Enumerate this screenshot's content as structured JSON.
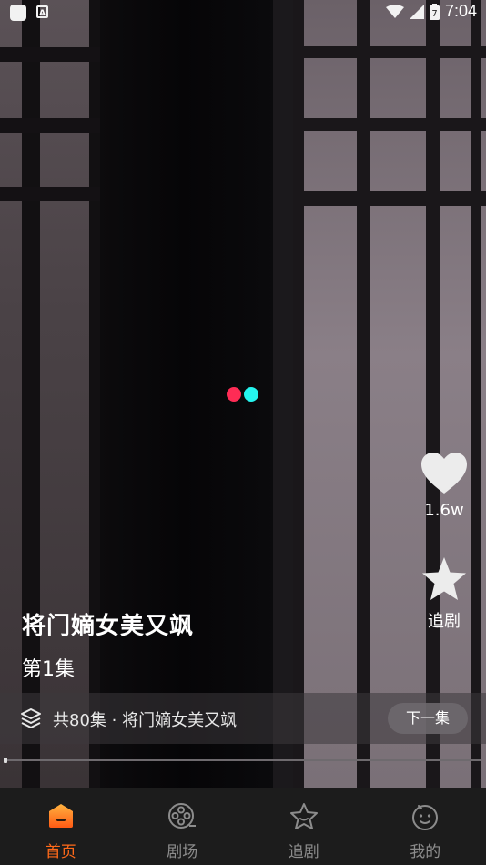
{
  "status_bar": {
    "time": "7:04",
    "icons": [
      "notification-square-icon",
      "a-badge-icon",
      "wifi-icon",
      "signal-icon",
      "battery-icon"
    ],
    "battery_level": "7"
  },
  "loading_indicator": {
    "colors": [
      "#fe2c55",
      "#25f4ee"
    ]
  },
  "side_actions": {
    "like": {
      "icon": "heart-icon",
      "count": "1.6w"
    },
    "follow": {
      "icon": "star-icon",
      "label": "追剧"
    }
  },
  "drama": {
    "title": "将门嫡女美又飒",
    "episode": "第1集"
  },
  "series_bar": {
    "icon": "layers-icon",
    "text": "共80集 · 将门嫡女美又飒",
    "next_label": "下一集"
  },
  "playback": {
    "progress": 0.0
  },
  "tab_bar": {
    "tabs": [
      {
        "label": "首页",
        "icon": "home-icon",
        "active": true
      },
      {
        "label": "剧场",
        "icon": "film-reel-icon",
        "active": false
      },
      {
        "label": "追剧",
        "icon": "star-outline-icon",
        "active": false
      },
      {
        "label": "我的",
        "icon": "profile-face-icon",
        "active": false
      }
    ]
  },
  "colors": {
    "accent": "#ff6a1a",
    "tab_inactive": "#8c8c8c",
    "tab_bg": "#1c1c1c"
  }
}
